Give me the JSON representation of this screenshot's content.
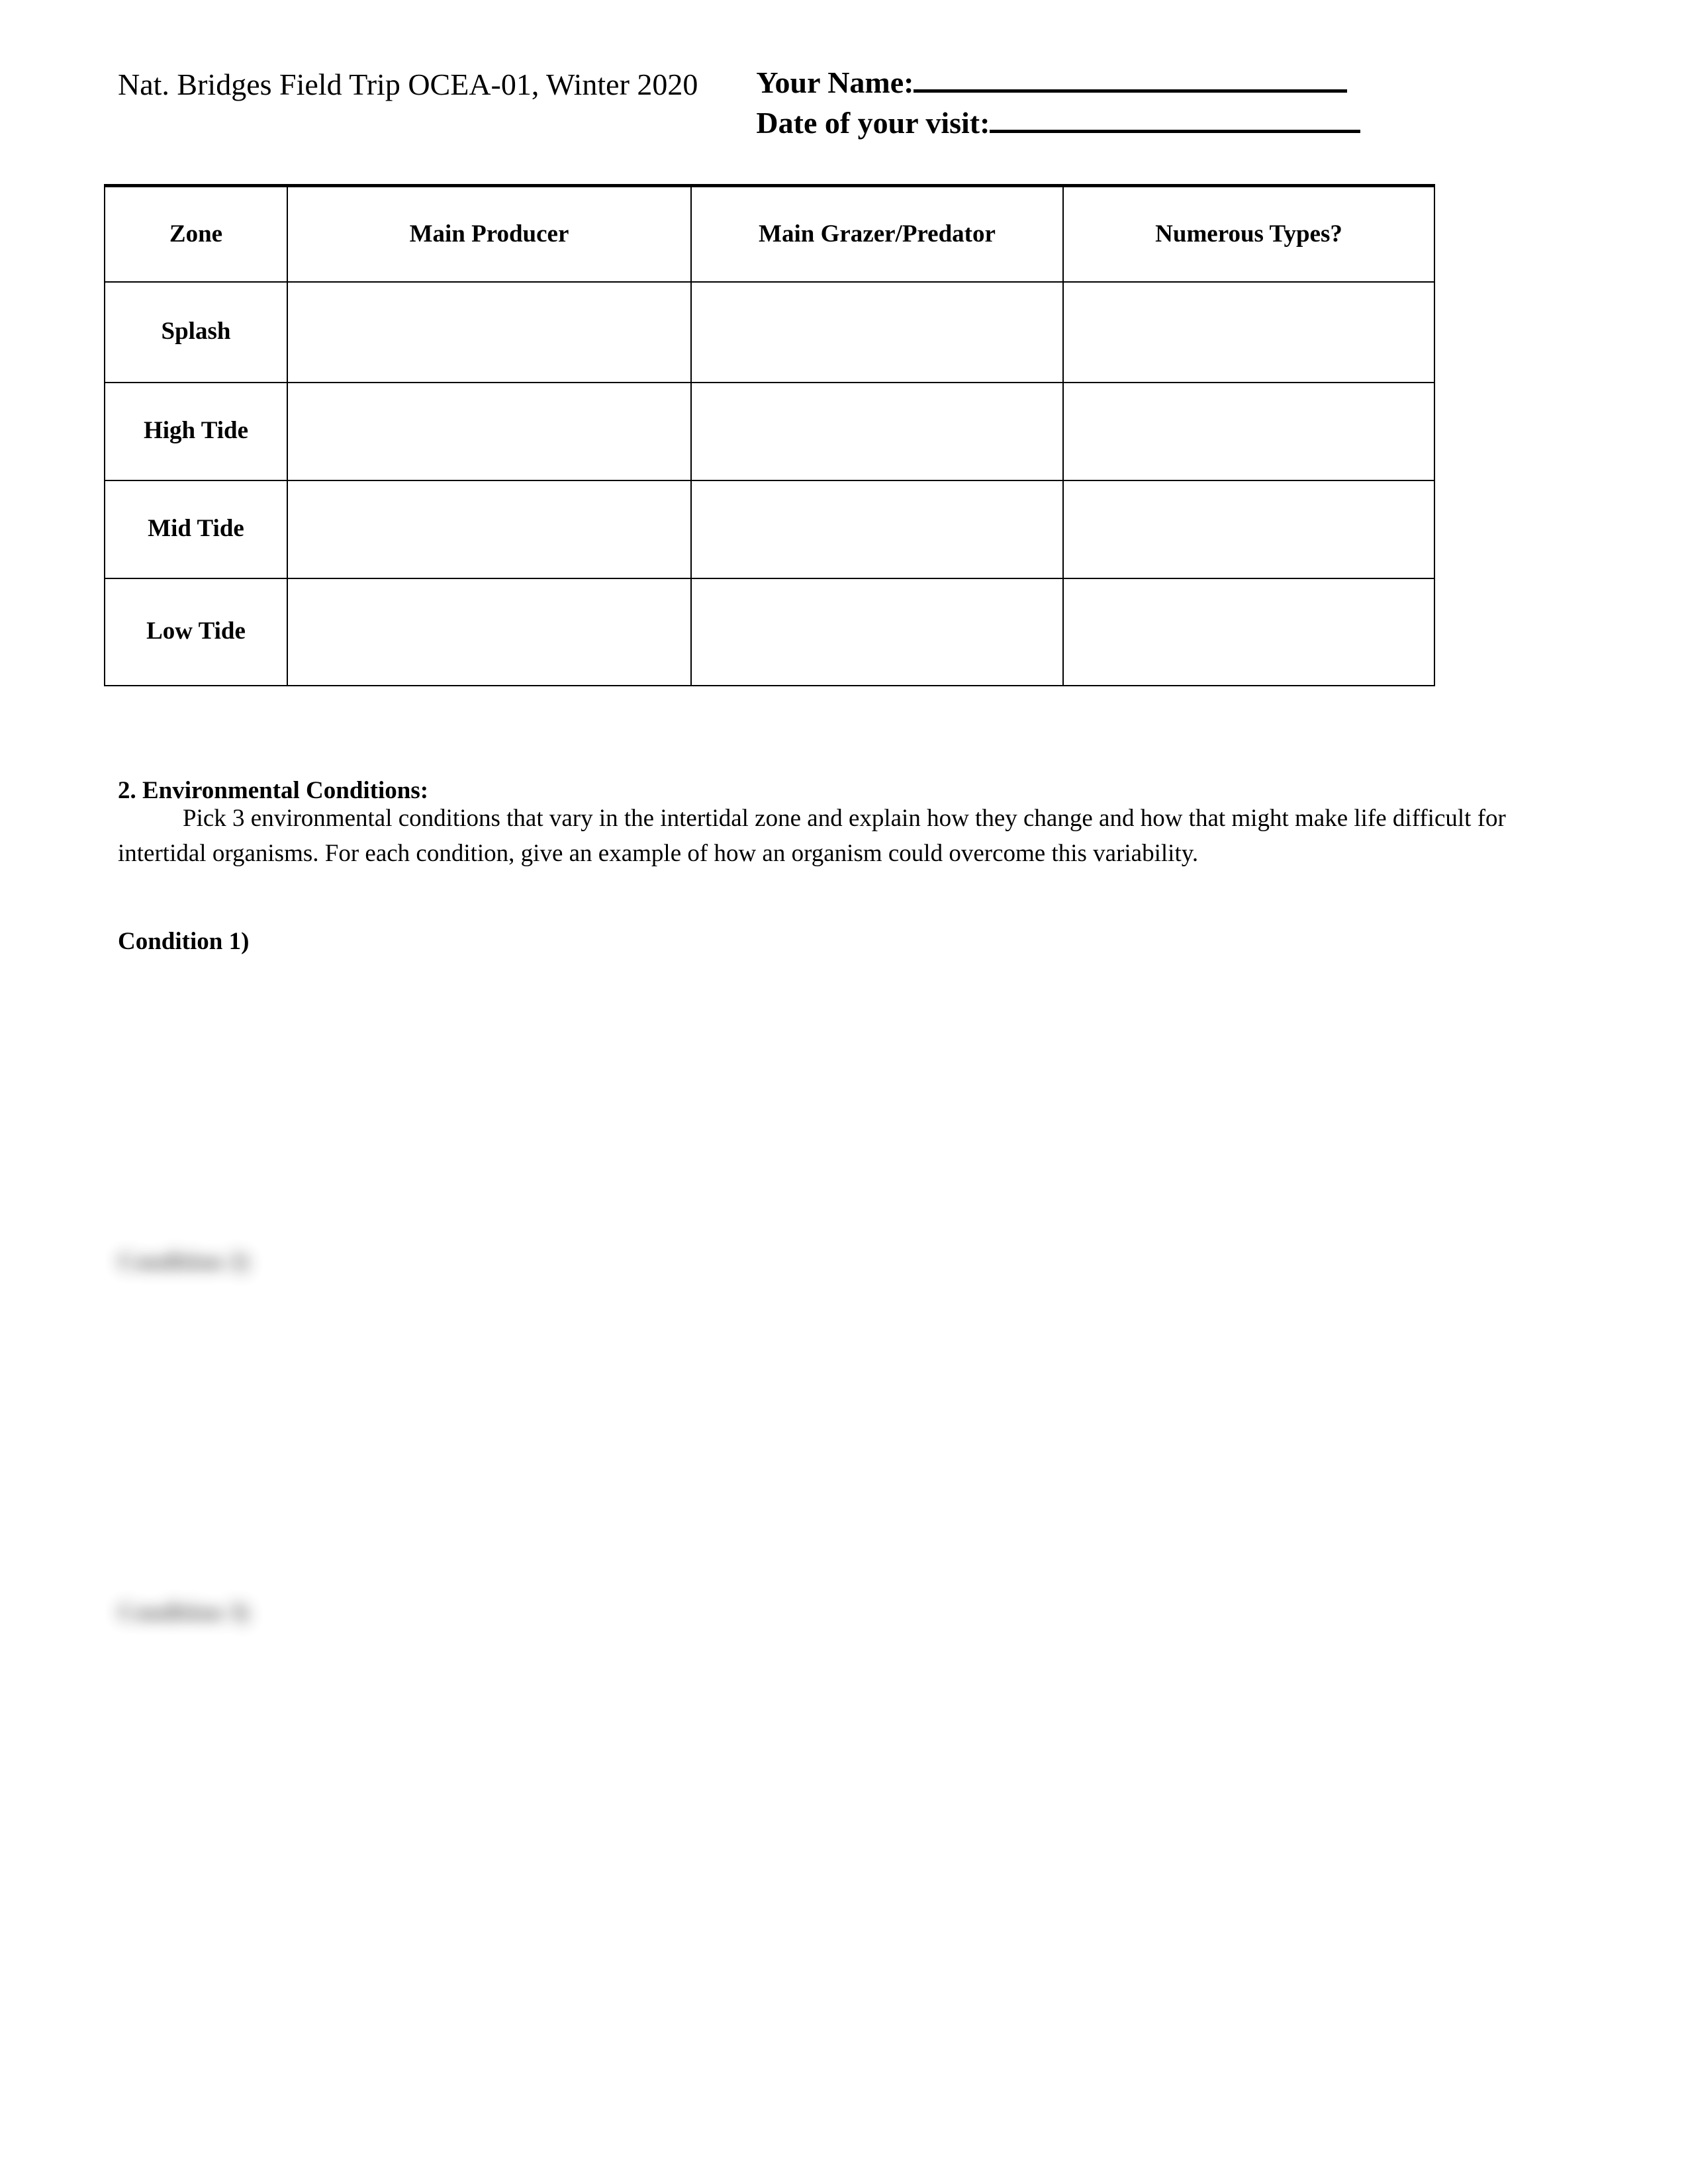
{
  "document": {
    "header": {
      "course_line": "Nat. Bridges Field Trip   OCEA-01, Winter 2020",
      "name_label": "Your Name:",
      "date_label": "Date of your visit:"
    },
    "table": {
      "columns": [
        "Zone",
        "Main Producer",
        "Main Grazer/Predator",
        "Numerous Types?"
      ],
      "rows": [
        {
          "zone": "Splash",
          "main_producer": "",
          "main_grazer_predator": "",
          "numerous_types": ""
        },
        {
          "zone": "High Tide",
          "main_producer": "",
          "main_grazer_predator": "",
          "numerous_types": ""
        },
        {
          "zone": "Mid Tide",
          "main_producer": "",
          "main_grazer_predator": "",
          "numerous_types": ""
        },
        {
          "zone": "Low Tide",
          "main_producer": "",
          "main_grazer_predator": "",
          "numerous_types": ""
        }
      ]
    },
    "section2": {
      "heading": "2. Environmental Conditions:",
      "body": "Pick 3 environmental conditions that vary in the intertidal zone and explain how they change and how that might make life difficult for intertidal organisms.  For each condition, give an example of how an organism could overcome this variability.",
      "condition_1": "Condition 1)",
      "condition_2_blurred": "Condition 2)",
      "condition_3_blurred": "Condition 3)"
    }
  }
}
